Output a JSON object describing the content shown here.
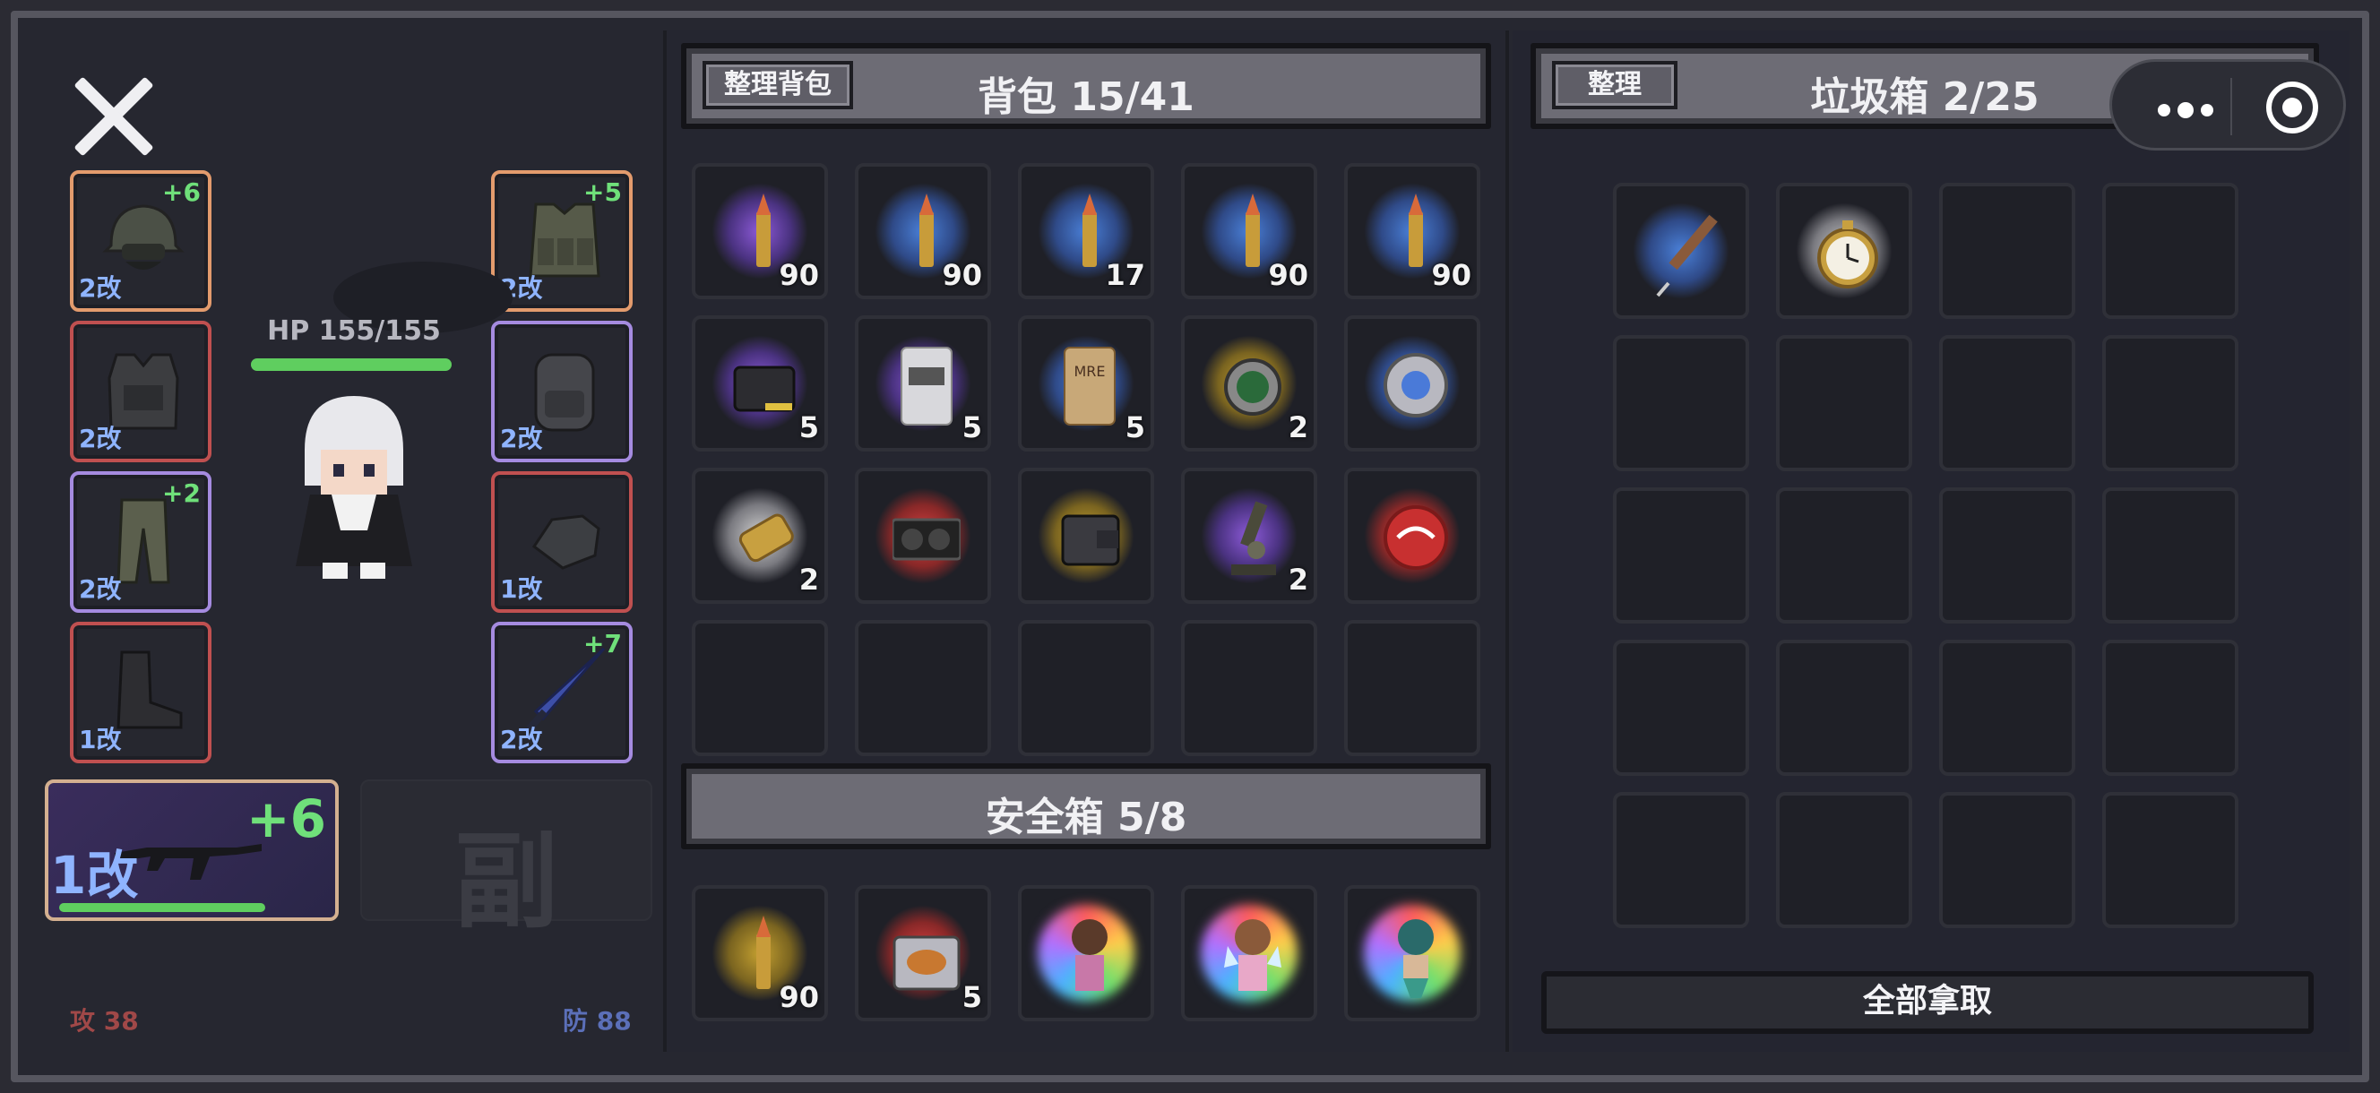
{
  "character": {
    "hp_text": "HP 155/155",
    "hp_fraction": 1.0,
    "attack_text": "攻 38",
    "defense_text": "防 88"
  },
  "equipment": {
    "helmet": {
      "plus": "+6",
      "mod": "2改",
      "icon": "helmet-icon"
    },
    "body_armor": {
      "plus": "",
      "mod": "2改",
      "icon": "armor-vest-icon"
    },
    "pants": {
      "plus": "+2",
      "mod": "2改",
      "icon": "pants-icon"
    },
    "boots": {
      "plus": "",
      "mod": "1改",
      "icon": "boots-icon"
    },
    "tactical_vest": {
      "plus": "+5",
      "mod": "2改",
      "icon": "tactical-vest-icon"
    },
    "backpack": {
      "plus": "",
      "mod": "2改",
      "icon": "backpack-icon"
    },
    "gloves": {
      "plus": "",
      "mod": "1改",
      "icon": "gloves-icon"
    },
    "melee": {
      "plus": "+7",
      "mod": "2改",
      "icon": "sword-icon"
    },
    "primary_weapon": {
      "plus": "+6",
      "mod": "1改",
      "icon": "rifle-icon",
      "durability_fraction": 0.85
    },
    "secondary_weapon": {
      "label": "副"
    }
  },
  "backpack": {
    "sort_button": "整理背包",
    "title": "背包 15/41",
    "items": [
      {
        "icon": "rifle-ammo-icon",
        "glow": "purple",
        "qty": "90"
      },
      {
        "icon": "rifle-ammo-icon",
        "glow": "blue",
        "qty": "90"
      },
      {
        "icon": "rifle-ammo-icon",
        "glow": "blue",
        "qty": "17"
      },
      {
        "icon": "rifle-ammo-icon",
        "glow": "blue",
        "qty": "90"
      },
      {
        "icon": "rifle-ammo-icon",
        "glow": "blue",
        "qty": "90"
      },
      {
        "icon": "ammo-box-icon",
        "glow": "purple",
        "qty": "5"
      },
      {
        "icon": "food-packet-icon",
        "glow": "purple",
        "qty": "5"
      },
      {
        "icon": "mre-ration-icon",
        "glow": "blue",
        "qty": "5"
      },
      {
        "icon": "scope-lens-icon",
        "glow": "gold",
        "qty": "2"
      },
      {
        "icon": "bearing-icon",
        "glow": "blue",
        "qty": ""
      },
      {
        "icon": "brass-casing-icon",
        "glow": "white",
        "qty": "2"
      },
      {
        "icon": "graphics-card-icon",
        "glow": "red",
        "qty": ""
      },
      {
        "icon": "wallet-icon",
        "glow": "gold",
        "qty": ""
      },
      {
        "icon": "microscope-icon",
        "glow": "purple",
        "qty": "2"
      },
      {
        "icon": "badge-icon",
        "glow": "red",
        "qty": ""
      }
    ]
  },
  "safe_box": {
    "title": "安全箱 5/8",
    "items": [
      {
        "icon": "rifle-ammo-icon",
        "glow": "gold",
        "qty": "90"
      },
      {
        "icon": "food-case-icon",
        "glow": "red",
        "qty": "5"
      },
      {
        "icon": "figurine-girl-icon",
        "glow": "rainbow",
        "qty": ""
      },
      {
        "icon": "figurine-fairy-icon",
        "glow": "rainbow",
        "qty": ""
      },
      {
        "icon": "figurine-mermaid-icon",
        "glow": "rainbow",
        "qty": ""
      }
    ]
  },
  "trash": {
    "sort_button": "整理",
    "title": "垃圾箱 2/25",
    "take_all": "全部拿取",
    "items": [
      {
        "icon": "syringe-icon",
        "glow": "blue"
      },
      {
        "icon": "pocket-watch-icon",
        "glow": "white"
      }
    ]
  },
  "system": {
    "menu_icon": "more-dots-icon",
    "record_icon": "target-icon"
  },
  "colors": {
    "plus": "#6fe07a",
    "mod": "#8fb4ff",
    "hp": "#5fce5f",
    "attack": "#a04848",
    "defense": "#5b6fb8"
  }
}
